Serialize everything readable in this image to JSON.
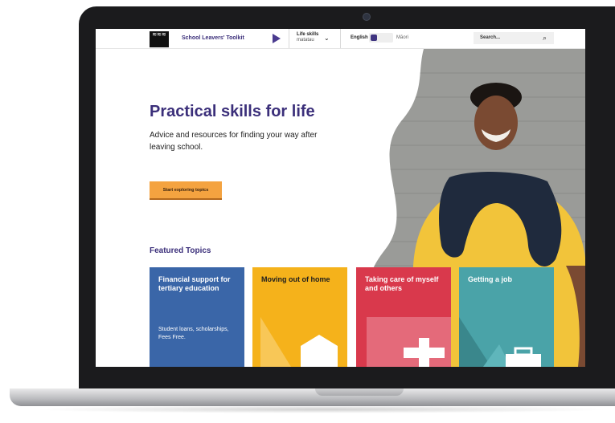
{
  "header": {
    "logo_text": "≋≋≋",
    "site_title": "School Leavers' Toolkit",
    "life_skills_label": "Life skills",
    "life_skills_sub": "matatau",
    "lang_english": "English",
    "lang_maori": "Māori",
    "search_placeholder": "Search..."
  },
  "hero": {
    "title": "Practical skills for life",
    "subtitle": "Advice and resources for finding your way after leaving school.",
    "cta_label": "Start exploring topics"
  },
  "featured": {
    "heading": "Featured Topics",
    "cards": [
      {
        "title": "Financial support for tertiary education",
        "description": "Student loans, scholarships, Fees Free.",
        "color": "#3a66a8"
      },
      {
        "title": "Moving out of home",
        "description": "",
        "color": "#f5b21b"
      },
      {
        "title": "Taking care of myself and others",
        "description": "",
        "color": "#d9394c"
      },
      {
        "title": "Getting a job",
        "description": "",
        "color": "#4aa3a8"
      }
    ]
  },
  "icons": {
    "logo": "logo-icon",
    "play": "play-icon",
    "dropdown": "chevron-down-icon",
    "search": "search-icon",
    "house": "house-icon",
    "plus": "plus-icon",
    "briefcase": "briefcase-icon"
  },
  "colors": {
    "brand": "#3b2f7a",
    "cta": "#f4a340"
  }
}
